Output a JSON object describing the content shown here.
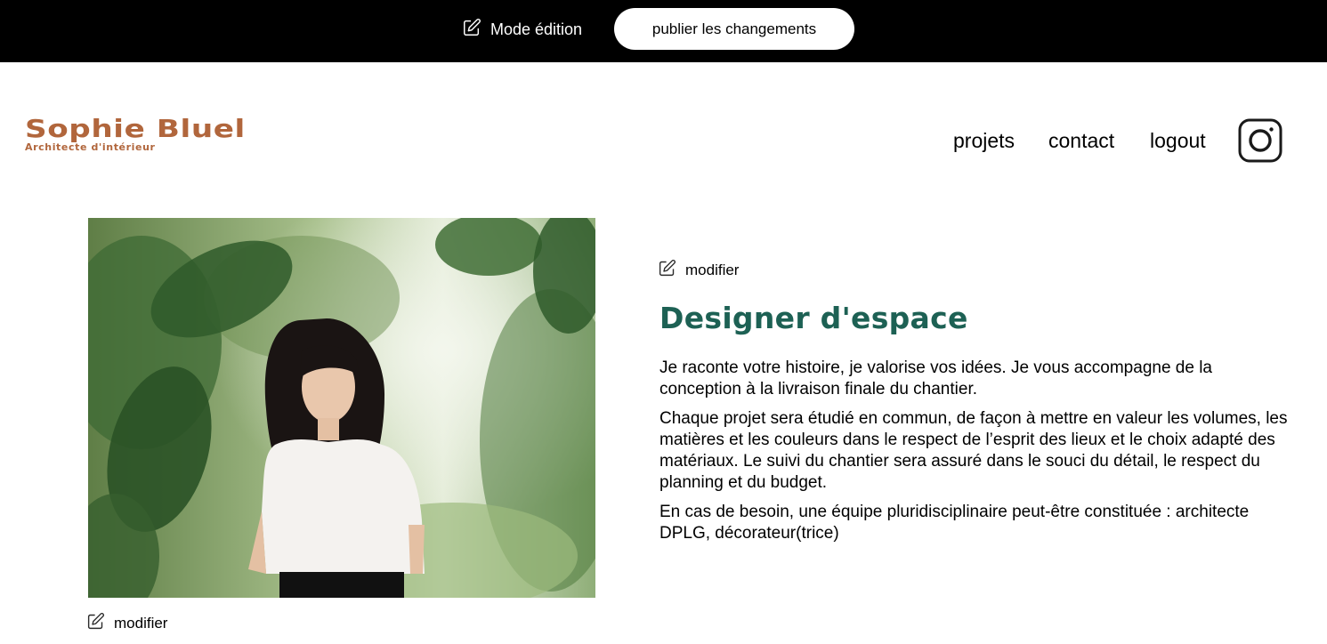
{
  "edit_bar": {
    "mode_label": "Mode édition",
    "publish_label": "publier les changements"
  },
  "brand": {
    "name": "Sophie Bluel",
    "subtitle": "Architecte d'intérieur",
    "color": "#b1663c"
  },
  "nav": {
    "items": [
      {
        "label": "projets"
      },
      {
        "label": "contact"
      },
      {
        "label": "logout"
      }
    ],
    "social_icon": "instagram-icon"
  },
  "introduction": {
    "photo_modify_label": "modifier",
    "text_modify_label": "modifier",
    "title": "Designer d'espace",
    "title_color": "#1d6154",
    "paragraphs": [
      "Je raconte votre histoire, je valorise vos idées. Je vous accompagne de la conception à la livraison finale du chantier.",
      "Chaque projet sera étudié en commun, de façon à mettre en valeur les volumes, les matières et les couleurs dans le respect de l’esprit des lieux et le choix adapté des matériaux. Le suivi du chantier sera assuré dans le souci du détail, le respect du planning et du budget.",
      "En cas de besoin, une équipe pluridisciplinaire peut-être constituée : architecte DPLG, décorateur(trice)"
    ]
  }
}
